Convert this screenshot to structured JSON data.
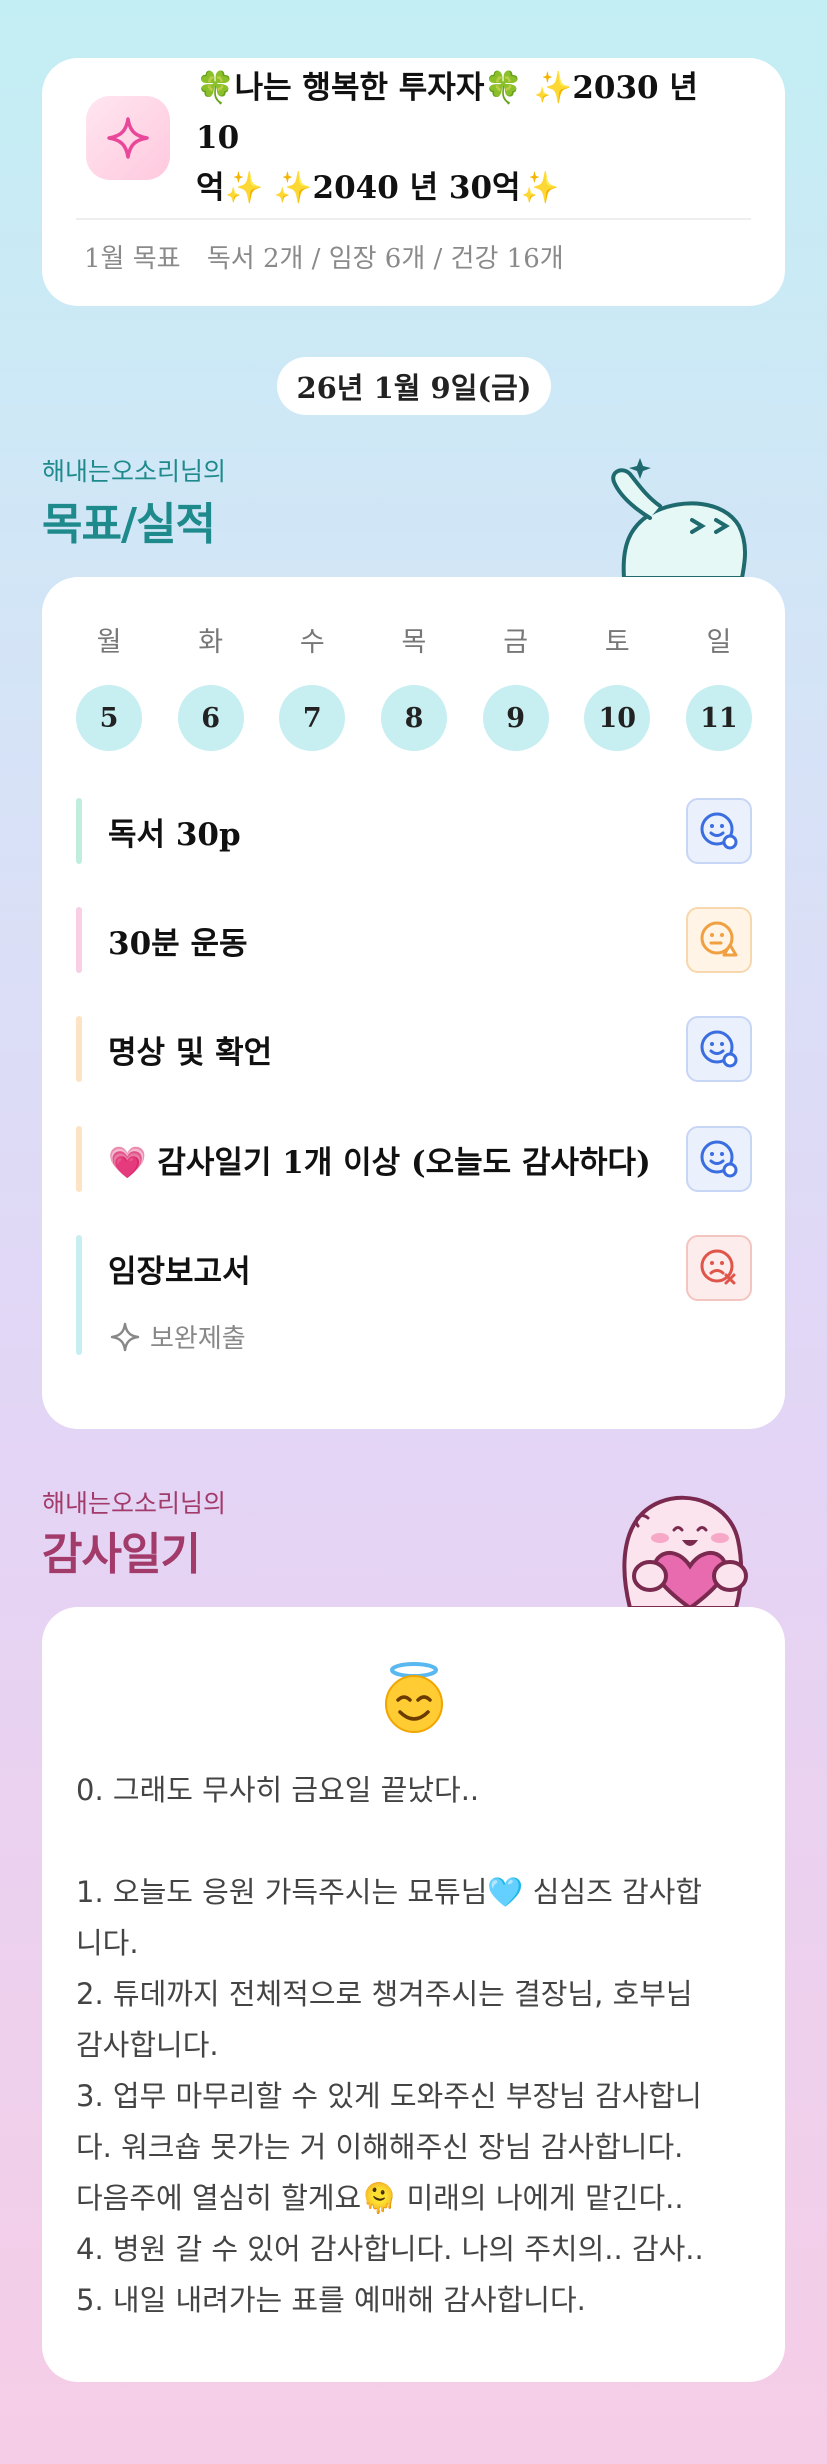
{
  "header": {
    "title_line1": "🍀나는 행복한 투자자🍀 ✨2030 년 10",
    "title_line2": "억✨ ✨2040 년 30억✨",
    "goal_label": "1월 목표",
    "goal_text": "독서 2개 / 임장 6개 / 건강 16개"
  },
  "date": "26년 1월 9일(금)",
  "goals_section": {
    "owner": "해내는오소리님의",
    "title": "목표/실적"
  },
  "week": {
    "weekdays": [
      "월",
      "화",
      "수",
      "목",
      "금",
      "토",
      "일"
    ],
    "days": [
      "5",
      "6",
      "7",
      "8",
      "9",
      "10",
      "11"
    ]
  },
  "tasks": [
    {
      "label": "독서 30p",
      "status": "done",
      "bar_color": "#bfeedd"
    },
    {
      "label": "30분 운동",
      "status": "partial",
      "bar_color": "#f8cfe4"
    },
    {
      "label": "명상 및 확언",
      "status": "done",
      "bar_color": "#fde2c4"
    },
    {
      "label": "💗 감사일기 1개 이상 (오늘도 감사하다)",
      "status": "done",
      "bar_color": "#fde2c4"
    },
    {
      "label": "임장보고서",
      "status": "failed",
      "bar_color": "#c7eef1"
    }
  ],
  "task_note": "보완제출",
  "diary_section": {
    "owner": "해내는오소리님의",
    "title": "감사일기"
  },
  "diary": {
    "emoji": "😇",
    "lines": [
      "0. 그래도 무사히 금요일 끝났다..",
      "",
      "1. 오늘도 응원 가득주시는 묘튜님🩵 심심즈 감사합",
      "니다.",
      "2. 튜데까지 전체적으로 챙겨주시는 결장님, 호부님",
      "감사합니다.",
      "3. 업무 마무리할 수 있게 도와주신 부장님 감사합니",
      "다. 워크숍 못가는 거 이해해주신 장님 감사합니다.",
      "다음주에 열심히 할게요🫠 미래의 나에게 맡긴다..",
      "4. 병원 갈 수 있어 감사합니다. 나의 주치의.. 감사..",
      "5. 내일 내려가는 표를 예매해 감사합니다."
    ]
  },
  "colors": {
    "goal_title": "#1f8a8c",
    "diary_title": "#a23a6a",
    "done": "#3a6de0",
    "partial": "#f0a040",
    "failed": "#e0554a"
  }
}
